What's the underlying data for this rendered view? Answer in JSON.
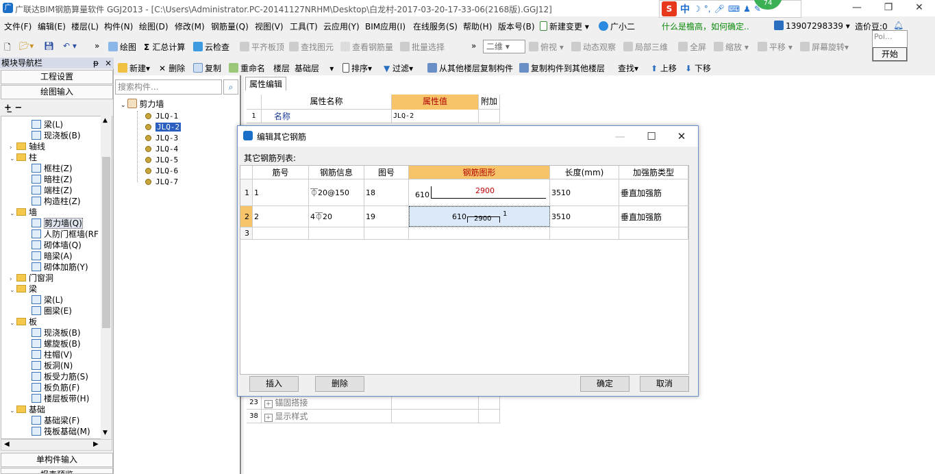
{
  "window": {
    "title": "广联达BIM钢筋算量软件 GGJ2013 - [C:\\Users\\Administrator.PC-20141127NRHM\\Desktop\\白龙村-2017-03-20-17-33-06(2168版).GGJ12]",
    "minimize": "—",
    "restore": "❐",
    "close": "✕"
  },
  "ime": {
    "logo": "S",
    "mode": "中",
    "badge": "74"
  },
  "menu": {
    "items": [
      "文件(F)",
      "编辑(E)",
      "楼层(L)",
      "构件(N)",
      "绘图(D)",
      "修改(M)",
      "钢筋量(Q)",
      "视图(V)",
      "工具(T)",
      "云应用(Y)",
      "BIM应用(I)",
      "在线服务(S)",
      "帮助(H)",
      "版本号(B)",
      "新建变更",
      "广小二"
    ],
    "promo": "什么是檐高，如何确定..",
    "phone": "13907298339",
    "coins": "造价豆:0"
  },
  "toolbar1": {
    "draw": "绘图",
    "sum": "汇总计算",
    "cloud_check": "云检查",
    "flush": "平齐板顶",
    "find_elem": "查找图元",
    "view_rebar": "查看钢筋量",
    "batch_select": "批量选择",
    "view_mode": "二维",
    "top_view": "俯视",
    "dynamic": "动态观察",
    "local3d": "局部三维",
    "fullscreen": "全屏",
    "zoom": "缩放",
    "pan": "平移",
    "rotate": "屏幕旋转"
  },
  "start_popup": {
    "hint": "Poi...",
    "start": "开始"
  },
  "toolbar2": {
    "new": "新建",
    "delete": "删除",
    "copy": "复制",
    "rename": "重命名",
    "floor_label": "楼层",
    "floor_value": "基础层",
    "sort": "排序",
    "filter": "过滤",
    "copy_from": "从其他楼层复制构件",
    "copy_to": "复制构件到其他楼层",
    "find": "查找",
    "move_up": "上移",
    "move_down": "下移"
  },
  "nav": {
    "header": "模块导航栏",
    "pin": "ᵽ",
    "close": "×",
    "project_settings": "工程设置",
    "drawing_input": "绘图输入",
    "single_input": "单构件输入",
    "report": "报表预览",
    "tree": [
      {
        "label": "梁(L)",
        "level": 2,
        "type": "comp"
      },
      {
        "label": "现浇板(B)",
        "level": 2,
        "type": "comp"
      },
      {
        "label": "轴线",
        "level": 1,
        "type": "folder",
        "expanded": false
      },
      {
        "label": "柱",
        "level": 1,
        "type": "folder",
        "expanded": true
      },
      {
        "label": "框柱(Z)",
        "level": 2,
        "type": "comp"
      },
      {
        "label": "暗柱(Z)",
        "level": 2,
        "type": "comp"
      },
      {
        "label": "端柱(Z)",
        "level": 2,
        "type": "comp"
      },
      {
        "label": "构造柱(Z)",
        "level": 2,
        "type": "comp"
      },
      {
        "label": "墙",
        "level": 1,
        "type": "folder",
        "expanded": true
      },
      {
        "label": "剪力墙(Q)",
        "level": 2,
        "type": "comp",
        "selected": true
      },
      {
        "label": "人防门框墙(RF",
        "level": 2,
        "type": "comp"
      },
      {
        "label": "砌体墙(Q)",
        "level": 2,
        "type": "comp"
      },
      {
        "label": "暗梁(A)",
        "level": 2,
        "type": "comp"
      },
      {
        "label": "砌体加筋(Y)",
        "level": 2,
        "type": "comp"
      },
      {
        "label": "门窗洞",
        "level": 1,
        "type": "folder",
        "expanded": false
      },
      {
        "label": "梁",
        "level": 1,
        "type": "folder",
        "expanded": true
      },
      {
        "label": "梁(L)",
        "level": 2,
        "type": "comp"
      },
      {
        "label": "圈梁(E)",
        "level": 2,
        "type": "comp"
      },
      {
        "label": "板",
        "level": 1,
        "type": "folder",
        "expanded": true
      },
      {
        "label": "现浇板(B)",
        "level": 2,
        "type": "comp"
      },
      {
        "label": "螺旋板(B)",
        "level": 2,
        "type": "comp"
      },
      {
        "label": "柱帽(V)",
        "level": 2,
        "type": "comp"
      },
      {
        "label": "板洞(N)",
        "level": 2,
        "type": "comp"
      },
      {
        "label": "板受力筋(S)",
        "level": 2,
        "type": "comp"
      },
      {
        "label": "板负筋(F)",
        "level": 2,
        "type": "comp"
      },
      {
        "label": "楼层板带(H)",
        "level": 2,
        "type": "comp"
      },
      {
        "label": "基础",
        "level": 1,
        "type": "folder",
        "expanded": true
      },
      {
        "label": "基础梁(F)",
        "level": 2,
        "type": "comp"
      },
      {
        "label": "筏板基础(M)",
        "level": 2,
        "type": "comp"
      }
    ]
  },
  "component_list": {
    "search_placeholder": "搜索构件...",
    "root": "剪力墙",
    "items": [
      "JLQ-1",
      "JLQ-2",
      "JLQ-3",
      "JLQ-4",
      "JLQ-5",
      "JLQ-6",
      "JLQ-7"
    ],
    "selected_index": 1
  },
  "props": {
    "tab": "属性编辑",
    "headers": [
      "属性名称",
      "属性值",
      "附加"
    ],
    "rows": [
      {
        "num": "1",
        "name": "名称",
        "value": "JLQ-2"
      },
      {
        "num": "23",
        "name": "锚固搭接",
        "value": "",
        "expand": "+"
      },
      {
        "num": "38",
        "name": "显示样式",
        "value": "",
        "expand": "+"
      }
    ]
  },
  "dialog": {
    "title": "编辑其它钢筋",
    "min": "—",
    "max": "☐",
    "close": "✕",
    "list_label": "其它钢筋列表:",
    "headers": [
      "筋号",
      "钢筋信息",
      "图号",
      "钢筋图形",
      "长度(mm)",
      "加强筋类型"
    ],
    "rows": [
      {
        "idx": "1",
        "num": "1",
        "info": "⏁20@150",
        "fig": "18",
        "shape_left": "610",
        "shape_top": "2900",
        "length": "3510",
        "type": "垂直加强筋"
      },
      {
        "idx": "2",
        "num": "2",
        "info": "4⏁20",
        "fig": "19",
        "shape_left": "610",
        "shape_mid": "2900",
        "shape_right": "1",
        "length": "3510",
        "type": "垂直加强筋"
      },
      {
        "idx": "3",
        "num": "",
        "info": "",
        "fig": "",
        "length": "",
        "type": ""
      }
    ],
    "buttons": {
      "insert": "插入",
      "delete": "删除",
      "ok": "确定",
      "cancel": "取消"
    }
  },
  "colors": {
    "accent": "#f7c46a",
    "selection": "#2a5fc0",
    "shape_label": "#c00000"
  }
}
